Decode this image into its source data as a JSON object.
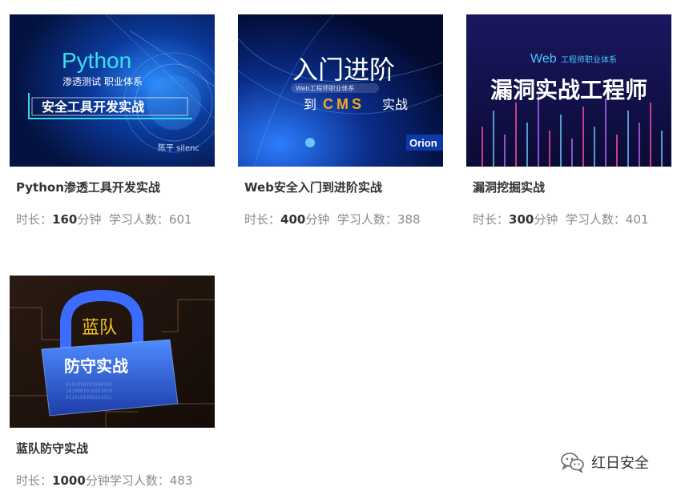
{
  "courses": [
    {
      "title": "Python渗透工具开发实战",
      "duration_label": "时长：",
      "duration_value": "160",
      "duration_unit": "分钟",
      "students_label": "学习人数：",
      "students_value": "601",
      "banner": {
        "line1": "Python",
        "line2": "渗透测试 职业体系",
        "line3": "安全工具开发实战",
        "author": "陈平 silenc"
      }
    },
    {
      "title": "Web安全入门到进阶实战",
      "duration_label": "时长：",
      "duration_value": "400",
      "duration_unit": "分钟",
      "students_label": "学习人数：",
      "students_value": "388",
      "banner": {
        "line1": "入门进阶",
        "line2": "Web工程师职业体系",
        "line3_prefix": "到",
        "line3_highlight": "CMS",
        "line3_suffix": "实战",
        "brand": "Orion"
      }
    },
    {
      "title": "漏洞挖掘实战",
      "duration_label": "时长：",
      "duration_value": "300",
      "duration_unit": "分钟",
      "students_label": "学习人数：",
      "students_value": "401",
      "banner": {
        "line1_web": "Web",
        "line1_rest": "工程师职业体系",
        "line2": "漏洞实战工程师"
      }
    },
    {
      "title": "蓝队防守实战",
      "duration_label": "时长：",
      "duration_value": "1000",
      "duration_unit": "分钟",
      "students_label": "学习人数：",
      "students_value": "483",
      "banner": {
        "line1": "蓝队",
        "line2": "防守实战"
      }
    }
  ],
  "watermark": {
    "text": "红日安全",
    "icon": "wechat-icon"
  }
}
